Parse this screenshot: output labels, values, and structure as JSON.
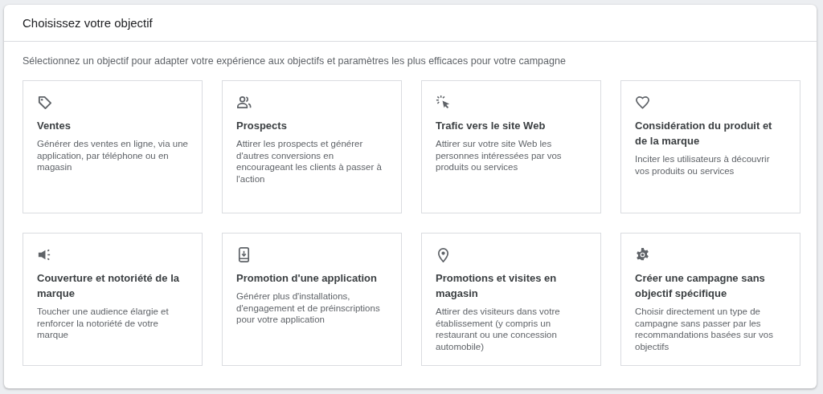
{
  "panel": {
    "title": "Choisissez votre objectif",
    "subtitle": "Sélectionnez un objectif pour adapter votre expérience aux objectifs et paramètres les plus efficaces pour votre campagne"
  },
  "objectives": [
    {
      "title": "Ventes",
      "description": "Générer des ventes en ligne, via une application, par téléphone ou en magasin"
    },
    {
      "title": "Prospects",
      "description": "Attirer les prospects et générer d'autres conversions en encourageant les clients à passer à l'action"
    },
    {
      "title": "Trafic vers le site Web",
      "description": "Attirer sur votre site Web les personnes intéressées par vos produits ou services"
    },
    {
      "title": "Considération du produit et de la marque",
      "description": "Inciter les utilisateurs à découvrir vos produits ou services"
    },
    {
      "title": "Couverture et notoriété de la marque",
      "description": "Toucher une audience élargie et renforcer la notoriété de votre marque"
    },
    {
      "title": "Promotion d'une application",
      "description": "Générer plus d'installations, d'engagement et de préinscriptions pour votre application"
    },
    {
      "title": "Promotions et visites en magasin",
      "description": "Attirer des visiteurs dans votre établissement (y compris un restaurant ou une concession automobile)"
    },
    {
      "title": "Créer une campagne sans objectif spécifique",
      "description": "Choisir directement un type de campagne sans passer par les recommandations basées sur vos objectifs"
    }
  ]
}
